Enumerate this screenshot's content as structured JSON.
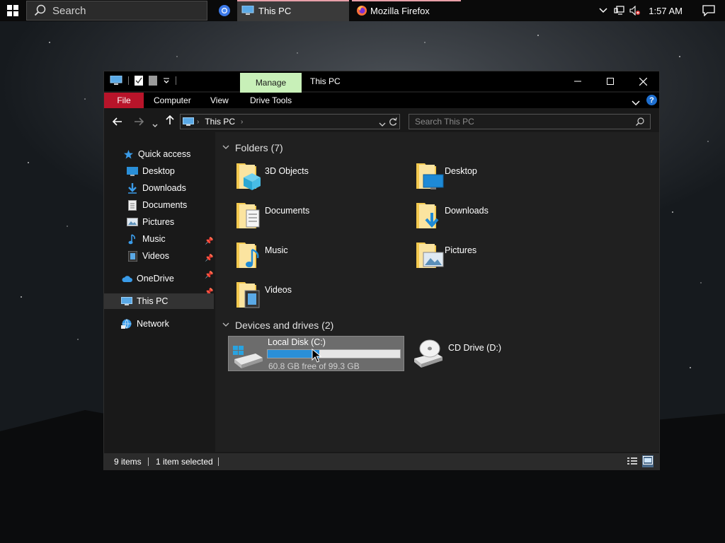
{
  "taskbar": {
    "search_placeholder": "Search",
    "apps": [
      {
        "label": "This PC",
        "icon": "this-pc-icon"
      },
      {
        "label": "Mozilla Firefox",
        "icon": "firefox-icon"
      }
    ],
    "clock": "1:57 AM"
  },
  "window": {
    "title": "This PC",
    "contextual_tab": "Manage",
    "ribbon_tabs": [
      "File",
      "Computer",
      "View",
      "Drive Tools"
    ],
    "address": "This PC",
    "search_placeholder": "Search This PC"
  },
  "nav": {
    "quick_access": "Quick access",
    "pinned": [
      {
        "label": "Desktop",
        "icon": "desktop-icon",
        "pinned": true
      },
      {
        "label": "Downloads",
        "icon": "downloads-icon",
        "pinned": true
      },
      {
        "label": "Documents",
        "icon": "documents-icon",
        "pinned": true
      },
      {
        "label": "Pictures",
        "icon": "pictures-icon",
        "pinned": true
      },
      {
        "label": "Music",
        "icon": "music-icon",
        "pinned": false
      },
      {
        "label": "Videos",
        "icon": "videos-icon",
        "pinned": false
      }
    ],
    "onedrive": "OneDrive",
    "this_pc": "This PC",
    "network": "Network"
  },
  "content": {
    "folders_header": "Folders (7)",
    "folders": [
      {
        "label": "3D Objects",
        "icon": "3d-objects-folder-icon"
      },
      {
        "label": "Desktop",
        "icon": "desktop-folder-icon"
      },
      {
        "label": "Documents",
        "icon": "documents-folder-icon"
      },
      {
        "label": "Downloads",
        "icon": "downloads-folder-icon"
      },
      {
        "label": "Music",
        "icon": "music-folder-icon"
      },
      {
        "label": "Pictures",
        "icon": "pictures-folder-icon"
      },
      {
        "label": "Videos",
        "icon": "videos-folder-icon"
      }
    ],
    "drives_header": "Devices and drives (2)",
    "drives": [
      {
        "label": "Local Disk (C:)",
        "free_text": "60.8 GB free of 99.3 GB",
        "used_fraction": 0.388,
        "selected": true
      },
      {
        "label": "CD Drive (D:)"
      }
    ]
  },
  "status": {
    "items": "9 items",
    "selected": "1 item selected"
  },
  "colors": {
    "file_tab": "#b8142a",
    "manage_tab": "#c8f0b8",
    "drive_bar": "#2a8fd8",
    "folder_yellow": "#f3c94f"
  }
}
